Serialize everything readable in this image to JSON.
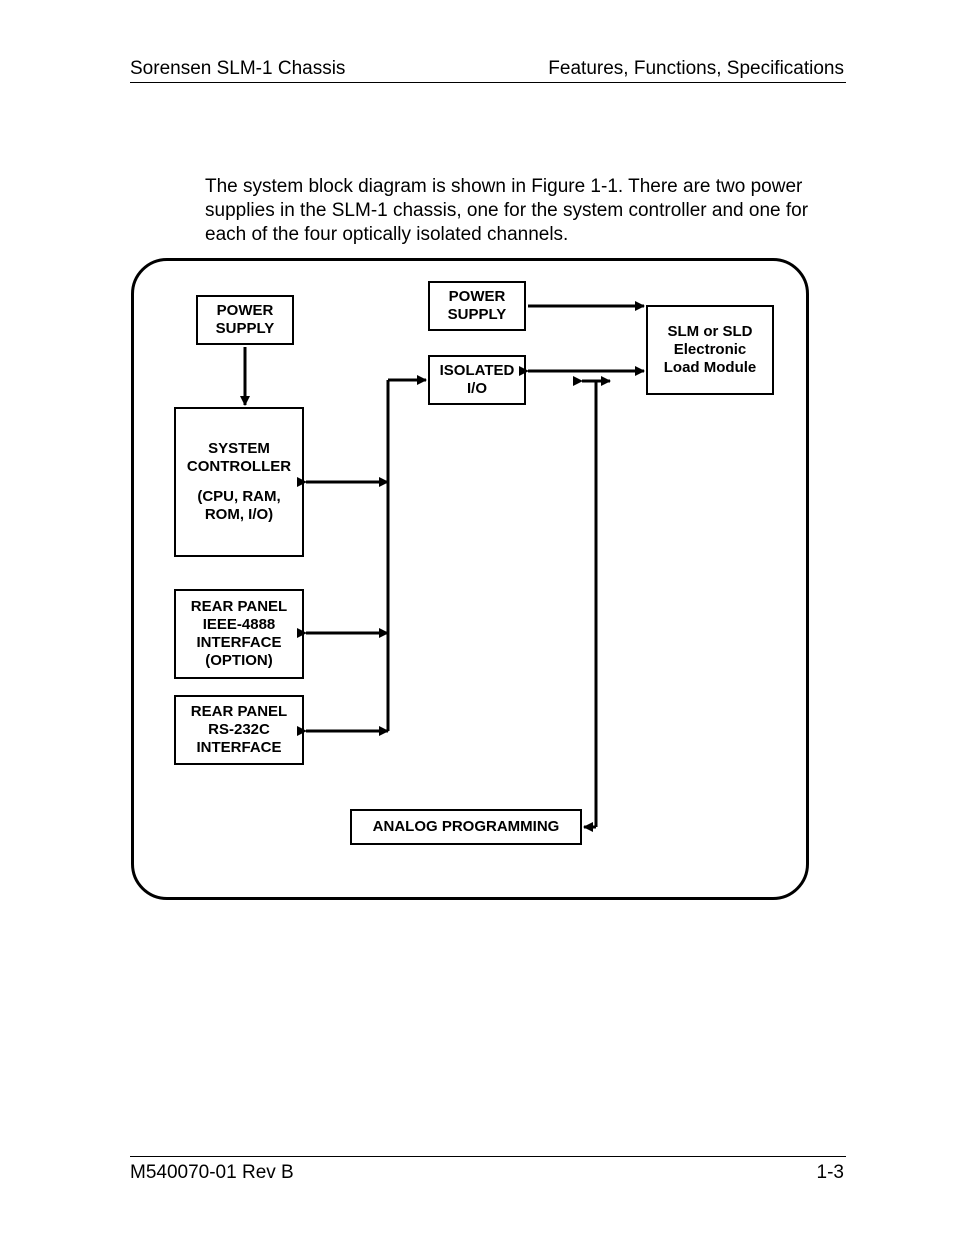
{
  "header": {
    "left": "Sorensen SLM-1 Chassis",
    "right": "Features, Functions, Specifications"
  },
  "body_paragraph": "The system block diagram is shown in Figure 1-1. There are two power supplies in the SLM-1 chassis, one for the system controller and one for each of the four optically isolated channels.",
  "diagram": {
    "power_supply_left_1": "POWER",
    "power_supply_left_2": "SUPPLY",
    "power_supply_right_1": "POWER",
    "power_supply_right_2": "SUPPLY",
    "isolated_io_1": "ISOLATED",
    "isolated_io_2": "I/O",
    "load_module_1": "SLM or SLD",
    "load_module_2": "Electronic",
    "load_module_3": "Load Module",
    "system_controller_1": "SYSTEM",
    "system_controller_2": "CONTROLLER",
    "system_controller_3": "(CPU, RAM,",
    "system_controller_4": "ROM, I/O)",
    "rear_ieee_1": "REAR PANEL",
    "rear_ieee_2": "IEEE-4888",
    "rear_ieee_3": "INTERFACE",
    "rear_ieee_4": "(OPTION)",
    "rear_rs_1": "REAR PANEL",
    "rear_rs_2": "RS-232C",
    "rear_rs_3": "INTERFACE",
    "analog_programming": "ANALOG PROGRAMMING"
  },
  "footer": {
    "left": "M540070-01 Rev B",
    "right": "1-3"
  }
}
